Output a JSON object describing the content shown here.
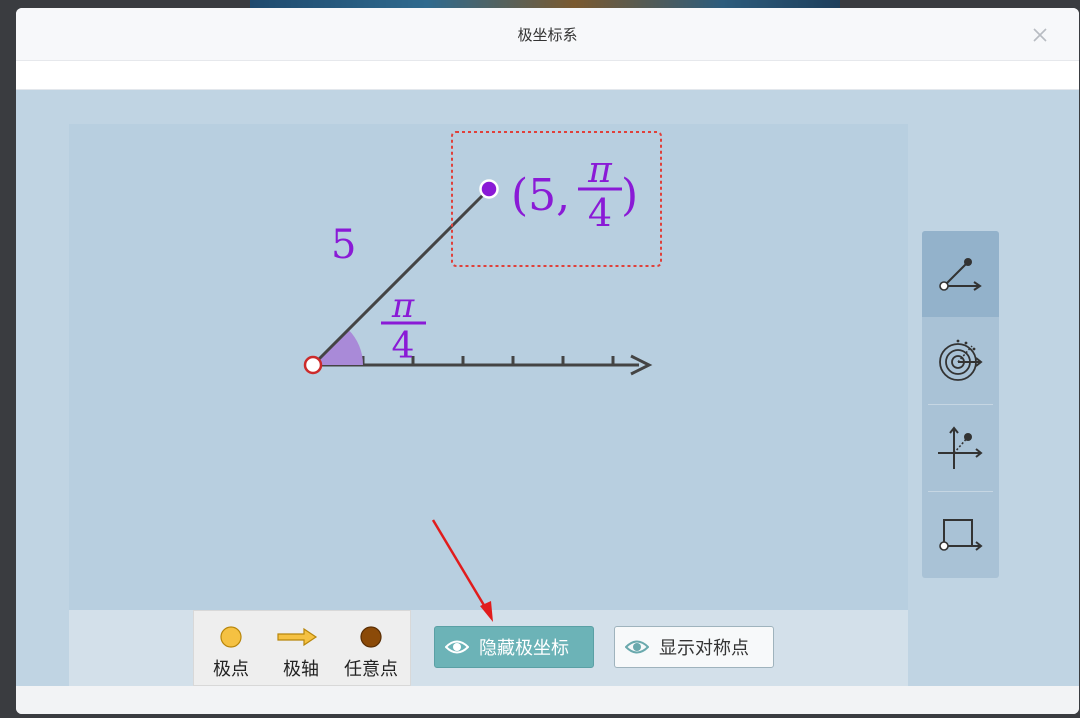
{
  "window": {
    "title": "极坐标系",
    "close_label": "×"
  },
  "plot": {
    "length_label": "5",
    "angle_numerator": "π",
    "angle_denominator": "4",
    "point_label_open": "(5,",
    "point_angle_numerator": "π",
    "point_angle_denominator": "4",
    "point_label_close": ")"
  },
  "legend": {
    "items": [
      {
        "label": "极点",
        "icon": "pole-dot-icon",
        "color": "#f5c142"
      },
      {
        "label": "极轴",
        "icon": "polar-axis-arrow-icon",
        "color": "#f5c142"
      },
      {
        "label": "任意点",
        "icon": "arbitrary-point-dot-icon",
        "color": "#8b4a08"
      }
    ]
  },
  "buttons": {
    "hide_polar": "隐藏极坐标",
    "show_symmetric": "显示对称点"
  },
  "toolbar": {
    "tools": [
      {
        "icon": "polar-point-tool-icon",
        "active": true
      },
      {
        "icon": "polar-grid-tool-icon",
        "active": false
      },
      {
        "icon": "cartesian-axes-tool-icon",
        "active": false
      },
      {
        "icon": "rectangle-tool-icon",
        "active": false
      }
    ]
  },
  "colors": {
    "accent_purple": "#8a1ad6",
    "axis": "#444444",
    "highlight_box": "#e0403a",
    "pole_stroke": "#cc2b2b",
    "angle_fill": "#a98ad8"
  }
}
